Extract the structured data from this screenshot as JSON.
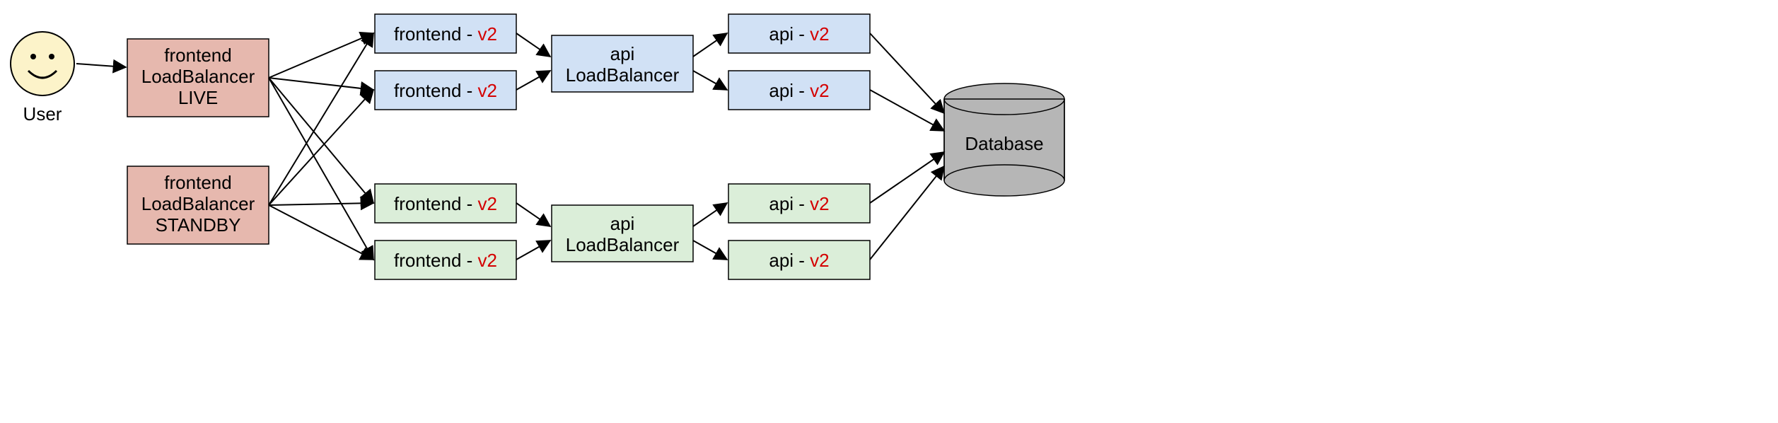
{
  "user": {
    "label": "User"
  },
  "loadbalancers": {
    "live": {
      "line1": "frontend",
      "line2": "LoadBalancer",
      "line3": "LIVE"
    },
    "standby": {
      "line1": "frontend",
      "line2": "LoadBalancer",
      "line3": "STANDBY"
    },
    "api_top": {
      "line1": "api",
      "line2": "LoadBalancer"
    },
    "api_bottom": {
      "line1": "api",
      "line2": "LoadBalancer"
    }
  },
  "frontend": {
    "top": [
      {
        "name": "frontend - ",
        "version": "v2"
      },
      {
        "name": "frontend - ",
        "version": "v2"
      }
    ],
    "bottom": [
      {
        "name": "frontend - ",
        "version": "v2"
      },
      {
        "name": "frontend - ",
        "version": "v2"
      }
    ]
  },
  "api": {
    "top": [
      {
        "name": "api - ",
        "version": "v2"
      },
      {
        "name": "api - ",
        "version": "v2"
      }
    ],
    "bottom": [
      {
        "name": "api - ",
        "version": "v2"
      },
      {
        "name": "api - ",
        "version": "v2"
      }
    ]
  },
  "database": {
    "label": "Database"
  },
  "chart_data": {
    "type": "diagram",
    "nodes": [
      {
        "id": "user",
        "label": "User",
        "kind": "actor"
      },
      {
        "id": "fe-lb-live",
        "label": "frontend LoadBalancer LIVE",
        "kind": "loadbalancer",
        "color": "pink"
      },
      {
        "id": "fe-lb-standby",
        "label": "frontend LoadBalancer STANDBY",
        "kind": "loadbalancer",
        "color": "pink"
      },
      {
        "id": "fe-v2-a",
        "label": "frontend - v2",
        "kind": "service",
        "color": "blue"
      },
      {
        "id": "fe-v2-b",
        "label": "frontend - v2",
        "kind": "service",
        "color": "blue"
      },
      {
        "id": "fe-v2-c",
        "label": "frontend - v2",
        "kind": "service",
        "color": "green"
      },
      {
        "id": "fe-v2-d",
        "label": "frontend - v2",
        "kind": "service",
        "color": "green"
      },
      {
        "id": "api-lb-top",
        "label": "api LoadBalancer",
        "kind": "loadbalancer",
        "color": "blue"
      },
      {
        "id": "api-lb-bot",
        "label": "api LoadBalancer",
        "kind": "loadbalancer",
        "color": "green"
      },
      {
        "id": "api-v2-a",
        "label": "api - v2",
        "kind": "service",
        "color": "blue"
      },
      {
        "id": "api-v2-b",
        "label": "api - v2",
        "kind": "service",
        "color": "blue"
      },
      {
        "id": "api-v2-c",
        "label": "api - v2",
        "kind": "service",
        "color": "green"
      },
      {
        "id": "api-v2-d",
        "label": "api - v2",
        "kind": "service",
        "color": "green"
      },
      {
        "id": "db",
        "label": "Database",
        "kind": "database"
      }
    ],
    "edges": [
      [
        "user",
        "fe-lb-live"
      ],
      [
        "fe-lb-live",
        "fe-v2-a"
      ],
      [
        "fe-lb-live",
        "fe-v2-b"
      ],
      [
        "fe-lb-live",
        "fe-v2-c"
      ],
      [
        "fe-lb-live",
        "fe-v2-d"
      ],
      [
        "fe-lb-standby",
        "fe-v2-a"
      ],
      [
        "fe-lb-standby",
        "fe-v2-b"
      ],
      [
        "fe-lb-standby",
        "fe-v2-c"
      ],
      [
        "fe-lb-standby",
        "fe-v2-d"
      ],
      [
        "fe-v2-a",
        "api-lb-top"
      ],
      [
        "fe-v2-b",
        "api-lb-top"
      ],
      [
        "fe-v2-c",
        "api-lb-bot"
      ],
      [
        "fe-v2-d",
        "api-lb-bot"
      ],
      [
        "api-lb-top",
        "api-v2-a"
      ],
      [
        "api-lb-top",
        "api-v2-b"
      ],
      [
        "api-lb-bot",
        "api-v2-c"
      ],
      [
        "api-lb-bot",
        "api-v2-d"
      ],
      [
        "api-v2-a",
        "db"
      ],
      [
        "api-v2-b",
        "db"
      ],
      [
        "api-v2-c",
        "db"
      ],
      [
        "api-v2-d",
        "db"
      ]
    ]
  }
}
